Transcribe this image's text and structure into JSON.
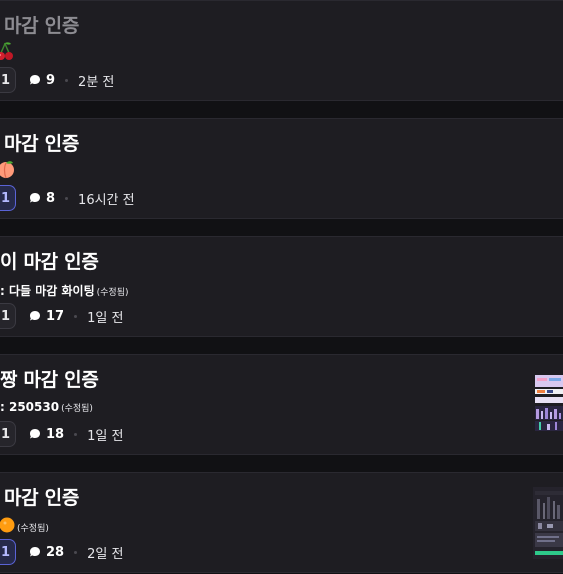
{
  "posts": [
    {
      "title": "마감 인증",
      "emoji": "cherry",
      "subtitle": "",
      "edited": "",
      "votes": "1",
      "comments": "9",
      "time": "2분 전"
    },
    {
      "title": "마감 인증",
      "emoji": "peach",
      "subtitle": "",
      "edited": "",
      "votes": "1",
      "comments": "8",
      "time": "16시간 전"
    },
    {
      "title": "이 마감 인증",
      "emoji": "",
      "subtitle": ": 다들 마감 화이팅",
      "edited": "(수정됨)",
      "votes": "1",
      "comments": "17",
      "time": "1일 전"
    },
    {
      "title": "짱 마감 인증",
      "emoji": "",
      "subtitle": ": 250530",
      "edited": "(수정됨)",
      "votes": "1",
      "comments": "18",
      "time": "1일 전"
    },
    {
      "title": "마감 인증",
      "emoji": "orange",
      "subtitle": "",
      "edited": "(수정됨)",
      "votes": "1",
      "comments": "28",
      "time": "2일 전"
    }
  ],
  "colors": {
    "card_bg": "#1e1d22",
    "page_bg": "#111114",
    "vote_active_border": "#5a63d6",
    "vote_active_text": "#b3b9ff"
  }
}
